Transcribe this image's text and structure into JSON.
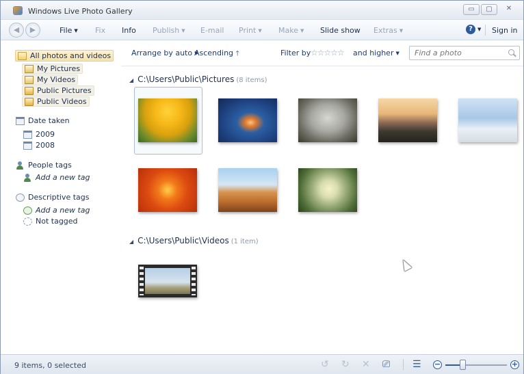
{
  "window": {
    "title": "Windows Live Photo Gallery",
    "minimize": "▭",
    "maximize": "▢",
    "close": "✕"
  },
  "commands": {
    "back": "◀",
    "forward": "▶",
    "file": "File",
    "fix": "Fix",
    "info": "Info",
    "publish": "Publish",
    "email": "E-mail",
    "print": "Print",
    "make": "Make",
    "slideshow": "Slide show",
    "extras": "Extras",
    "help": "?",
    "signin": "Sign in"
  },
  "sidebar": {
    "all": "All photos and videos",
    "folders": [
      {
        "label": "My Pictures"
      },
      {
        "label": "My Videos"
      },
      {
        "label": "Public Pictures"
      },
      {
        "label": "Public Videos"
      }
    ],
    "date_taken": "Date taken",
    "years": [
      "2009",
      "2008"
    ],
    "people_tags": "People tags",
    "add_people_tag": "Add a new tag",
    "descriptive_tags": "Descriptive tags",
    "add_descriptive_tag": "Add a new tag",
    "not_tagged": "Not tagged"
  },
  "filterbar": {
    "arrange": "Arrange by auto",
    "ascending": "Ascending",
    "ascending_arrow": "🡑",
    "filter_by": "Filter by",
    "stars": "☆☆☆☆☆",
    "and_higher": "and higher",
    "search_placeholder": "Find a photo"
  },
  "groups": [
    {
      "path": "C:\\Users\\Public\\Pictures",
      "count": "(8 items)"
    },
    {
      "path": "C:\\Users\\Public\\Videos",
      "count": "(1 item)"
    }
  ],
  "status": {
    "text": "9 items, 0 selected",
    "zoom_level": 0.28
  },
  "colors": {
    "accent": "#2f5b98",
    "selection": "#f6e2a8"
  }
}
